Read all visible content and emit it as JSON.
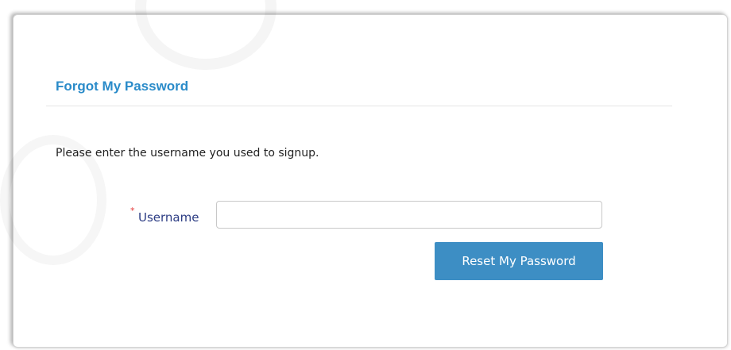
{
  "form": {
    "title": "Forgot My Password",
    "instructions": "Please enter the username you used to signup.",
    "username": {
      "required_marker": "*",
      "label": "Username",
      "value": "",
      "placeholder": ""
    },
    "reset_button_label": "Reset My Password"
  },
  "colors": {
    "title": "#2a8bc9",
    "label": "#2d3d84",
    "required": "#e53b3b",
    "button": "#3d8ec4",
    "button_text": "#ffffff"
  }
}
